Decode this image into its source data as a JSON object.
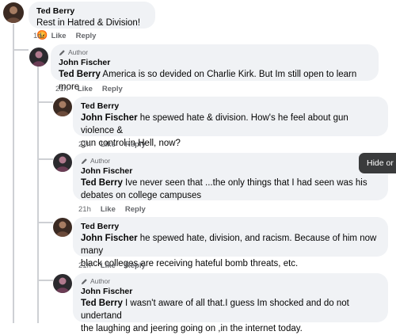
{
  "comments": [
    {
      "author": "Ted Berry",
      "is_author": false,
      "badge": "",
      "mention": "",
      "text": "Rest in Hatred & Division!😡",
      "time": "1d",
      "like_label": "Like",
      "reply_label": "Reply"
    },
    {
      "author": "John Fischer",
      "is_author": true,
      "badge": "Author",
      "mention": "Ted Berry",
      "text": " America is so devided on Charlie Kirk. But Im still open to learn more .",
      "time": "21h",
      "like_label": "Like",
      "reply_label": "Reply"
    },
    {
      "author": "Ted Berry",
      "is_author": false,
      "badge": "",
      "mention": "John Fischer",
      "text_line1": " he spewed hate & division. How's he feel about gun violence &",
      "text_line2": "gun control in Hell, now?",
      "time": "21h",
      "like_label": "Like",
      "reply_label": "Reply"
    },
    {
      "author": "John Fischer",
      "is_author": true,
      "badge": "Author",
      "mention": "Ted Berry",
      "text_line1": " Ive never seen that ...the only things that I had seen was his",
      "text_line2": "debates on college campuses",
      "time": "21h",
      "like_label": "Like",
      "reply_label": "Reply"
    },
    {
      "author": "Ted Berry",
      "is_author": false,
      "badge": "",
      "mention": "John Fischer",
      "text_line1": " he spewed hate, division, and racism. Because of him now many",
      "text_line2": "black colleges are receiving hateful bomb threats, etc.",
      "time": "21h",
      "like_label": "Like",
      "reply_label": "Reply"
    },
    {
      "author": "John Fischer",
      "is_author": true,
      "badge": "Author",
      "mention": "Ted Berry",
      "text_line1": " I wasn't aware of all that.I guess Im shocked and do not undertand",
      "text_line2": "the laughing and jeering going on ,in the internet today."
    }
  ],
  "tooltip": {
    "label": "Hide or"
  },
  "colors": {
    "bubble": "#f0f2f5",
    "meta": "#65676b",
    "text": "#050505",
    "thread_line": "#ced0d4",
    "tooltip_bg": "#3a3b3c"
  },
  "icons": {
    "author_badge": "pencil-icon"
  }
}
